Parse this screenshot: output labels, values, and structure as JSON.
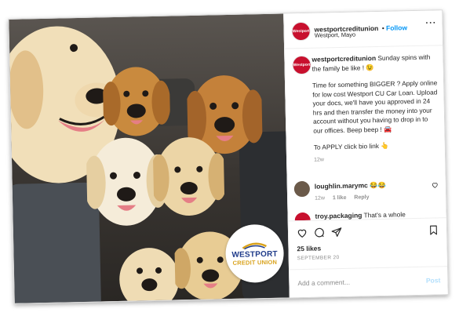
{
  "post": {
    "username": "westportcreditunion",
    "follow_label": "Follow",
    "location": "Westport, Mayo",
    "more_label": "···",
    "caption_lead": "Sunday spins with the family be like ! 😉",
    "caption_body": "Time for something BIGGER ? Apply online for low cost Westport CU Car Loan. Upload your docs, we'll have you approved in 24 hrs and then transfer the money into your account without you having to drop in to our offices. Beep beep ! 🚘",
    "caption_cta": "To APPLY click bio link 👆",
    "caption_age": "12w",
    "likes": "25 likes",
    "date": "SEPTEMBER 20",
    "add_comment_placeholder": "Add a comment...",
    "post_label": "Post"
  },
  "comments": [
    {
      "user": "loughlin.marymc",
      "text": "😂😂",
      "age": "12w",
      "likes": "1 like",
      "reply": "Reply"
    },
    {
      "user": "troy.packaging",
      "text": "That's a whole"
    }
  ],
  "logo": {
    "line1": "WESTPORT",
    "line2": "CREDIT UNION",
    "avatar_text": "Westport"
  },
  "colors": {
    "brand_red": "#c8102e",
    "link_blue": "#0095f6",
    "logo_navy": "#1f3b8a",
    "logo_gold": "#d9a21b"
  }
}
